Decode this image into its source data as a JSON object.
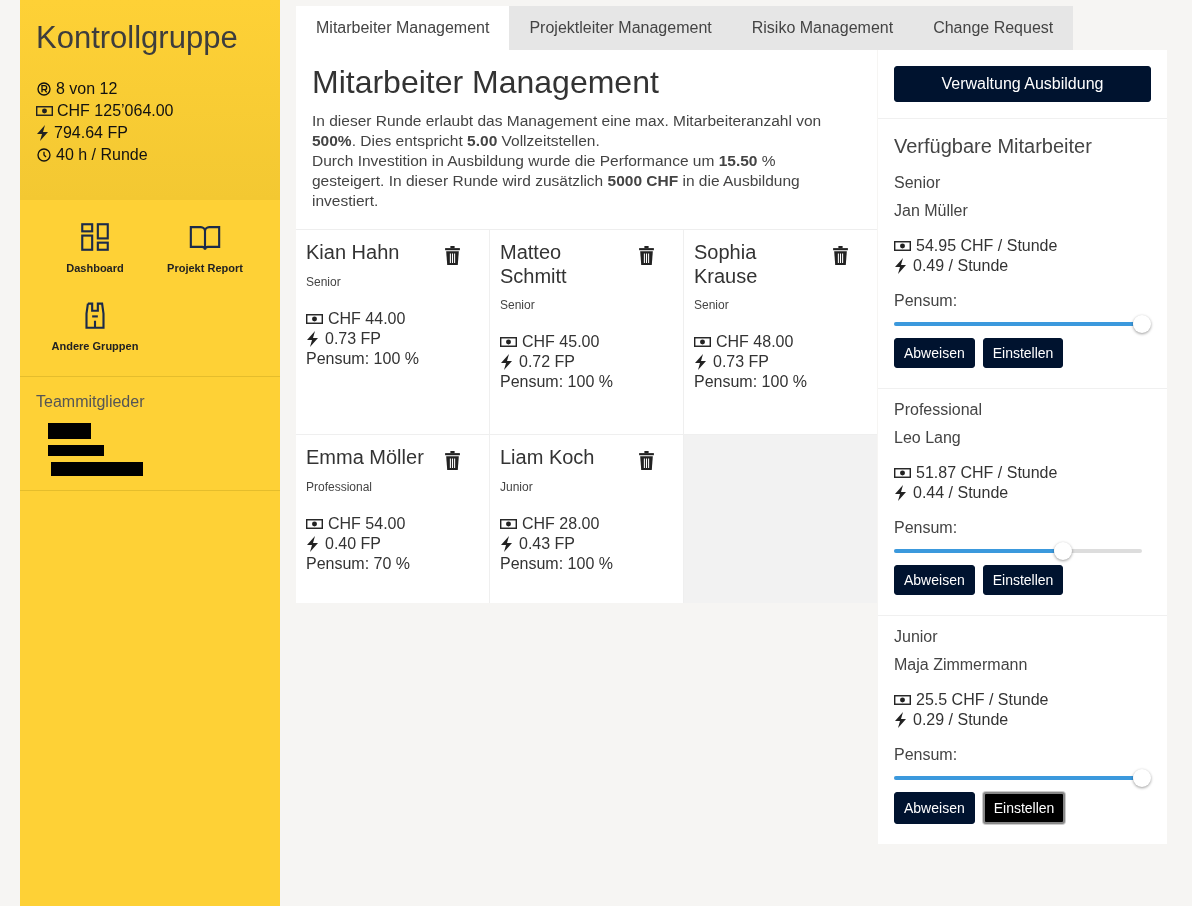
{
  "sidebar": {
    "title": "Kontrollgruppe",
    "stats": [
      {
        "kind": "round",
        "text": "8 von 12"
      },
      {
        "kind": "money",
        "text": "CHF 125’064.00"
      },
      {
        "kind": "power",
        "text": "794.64 FP"
      },
      {
        "kind": "time",
        "text": "40 h / Runde"
      }
    ],
    "nav": [
      {
        "kind": "dashboard",
        "label": "Dashboard"
      },
      {
        "kind": "report",
        "label": "Projekt Report"
      },
      {
        "kind": "groups",
        "label": "Andere Gruppen"
      }
    ],
    "team_heading": "Teammitglieder"
  },
  "tabs": [
    {
      "label": "Mitarbeiter Management",
      "selected": true
    },
    {
      "label": "Projektleiter Management",
      "selected": false
    },
    {
      "label": "Risiko Management",
      "selected": false
    },
    {
      "label": "Change Request",
      "selected": false
    }
  ],
  "main": {
    "heading": "Mitarbeiter Management",
    "paragraphs": [
      "In dieser Runde erlaubt das Management eine max. Mitarbeiteranzahl von **500%**. Dies entspricht **5.00** Vollzeitstellen.",
      "Durch Investition in Ausbildung wurde die Performance um **15.50** % gesteigert. In dieser Runde wird zusätzlich **5000 CHF** in die Ausbildung investiert."
    ],
    "employees": [
      {
        "name": "Kian Hahn",
        "level": "Senior",
        "cost": "CHF 44.00",
        "fp": "0.73 FP",
        "pensum": "Pensum: 100 %"
      },
      {
        "name": "Matteo Schmitt",
        "level": "Senior",
        "cost": "CHF 45.00",
        "fp": "0.72 FP",
        "pensum": "Pensum: 100 %"
      },
      {
        "name": "Sophia Krause",
        "level": "Senior",
        "cost": "CHF 48.00",
        "fp": "0.73 FP",
        "pensum": "Pensum: 100 %"
      },
      {
        "name": "Emma Möller",
        "level": "Professional",
        "cost": "CHF 54.00",
        "fp": "0.40 FP",
        "pensum": "Pensum: 70 %"
      },
      {
        "name": "Liam Koch",
        "level": "Junior",
        "cost": "CHF 28.00",
        "fp": "0.43 FP",
        "pensum": "Pensum: 100 %"
      }
    ]
  },
  "right_panel": {
    "training_button": "Verwaltung Ausbildung",
    "heading": "Verfügbare Mitarbeiter",
    "candidates": [
      {
        "level_label": "Senior",
        "name": "Jan Müller",
        "cost": "54.95 CHF / Stunde",
        "fp": "0.49 / Stunde",
        "pensum_label": "Pensum:",
        "slider": {
          "level": 1
        },
        "buttons": [
          {
            "label": "Abweisen",
            "focused": false
          },
          {
            "label": "Einstellen",
            "focused": false
          }
        ]
      },
      {
        "level_label": "Professional",
        "name": "Leo Lang",
        "cost": "51.87 CHF / Stunde",
        "fp": "0.44 / Stunde",
        "pensum_label": "Pensum:",
        "slider": {
          "level": 0.67
        },
        "buttons": [
          {
            "label": "Abweisen",
            "focused": false
          },
          {
            "label": "Einstellen",
            "focused": false
          }
        ]
      },
      {
        "level_label": "Junior",
        "name": "Maja Zimmermann",
        "cost": "25.5 CHF / Stunde",
        "fp": "0.29 / Stunde",
        "pensum_label": "Pensum:",
        "slider": {
          "level": 1
        },
        "buttons": [
          {
            "label": "Abweisen",
            "focused": false
          },
          {
            "label": "Einstellen",
            "focused": true
          }
        ]
      }
    ]
  }
}
